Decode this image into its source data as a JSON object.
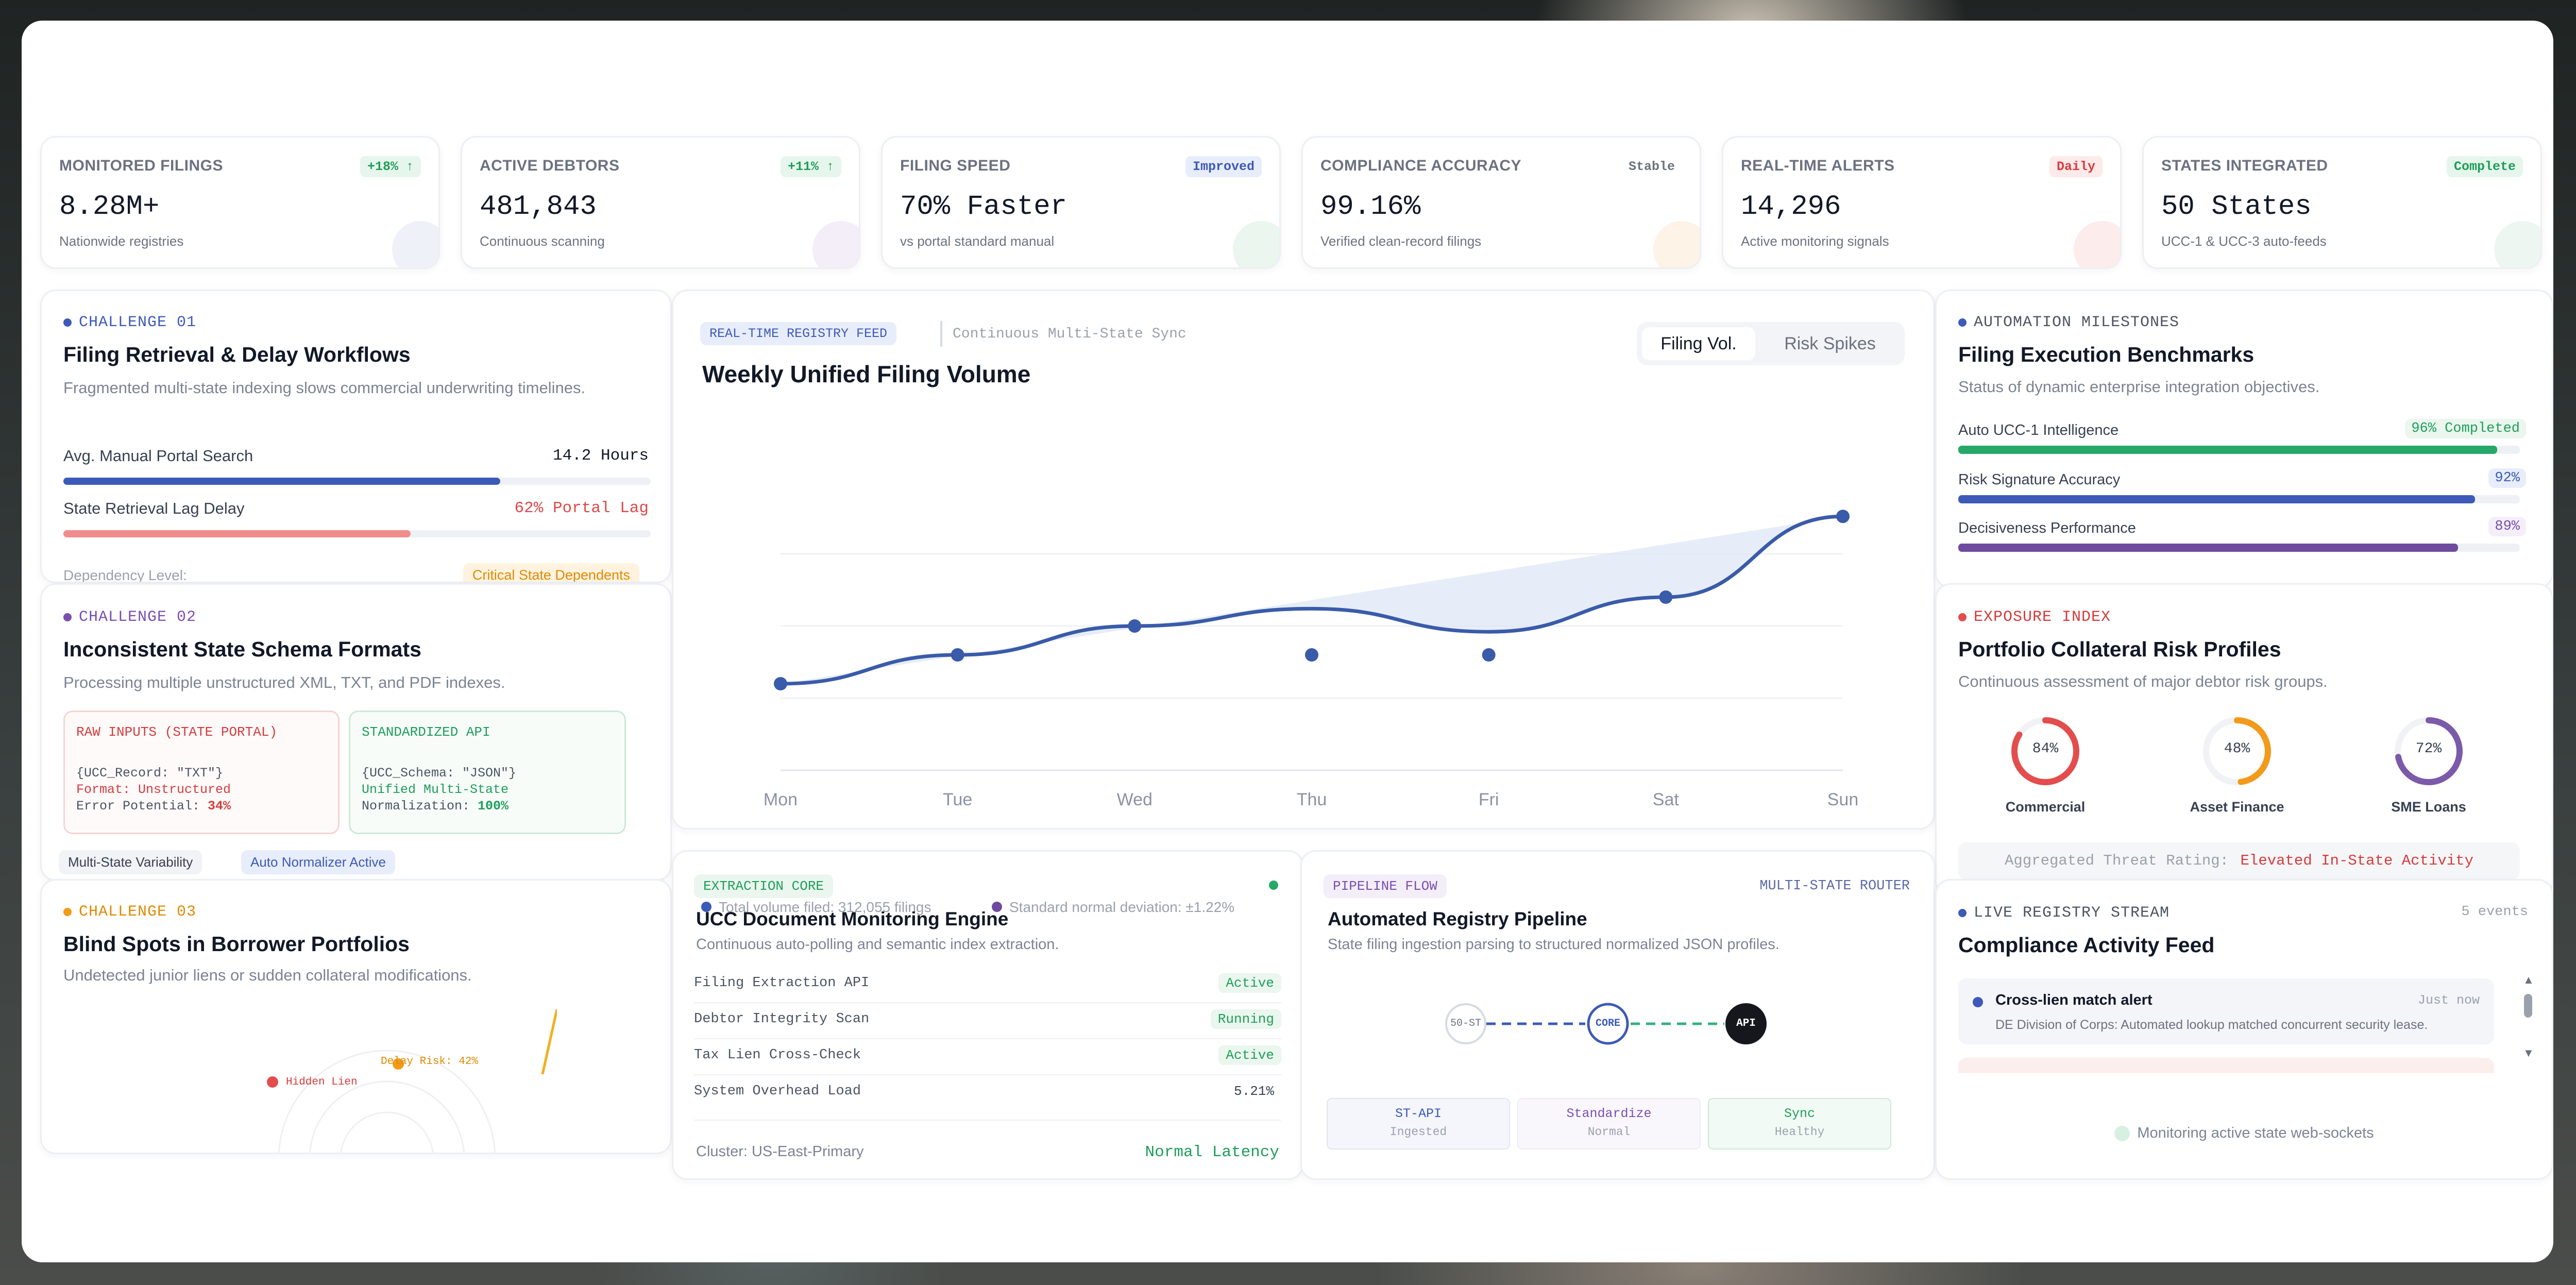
{
  "kpis": [
    {
      "label": "MONITORED FILINGS",
      "badge": "+18% ↑",
      "value": "8.28M+",
      "sub": "Nationwide registries"
    },
    {
      "label": "ACTIVE DEBTORS",
      "badge": "+11% ↑",
      "value": "481,843",
      "sub": "Continuous scanning"
    },
    {
      "label": "FILING SPEED",
      "badge": "Improved",
      "value": "70% Faster",
      "sub": "vs portal standard manual"
    },
    {
      "label": "COMPLIANCE ACCURACY",
      "badge": "Stable",
      "value": "99.16%",
      "sub": "Verified clean-record filings"
    },
    {
      "label": "REAL-TIME ALERTS",
      "badge": "Daily",
      "value": "14,296",
      "sub": "Active monitoring signals"
    },
    {
      "label": "STATES INTEGRATED",
      "badge": "Complete",
      "value": "50 States",
      "sub": "UCC-1 & UCC-3 auto-feeds"
    }
  ],
  "challenge1": {
    "tag": "CHALLENGE 01",
    "title": "Filing Retrieval & Delay Workflows",
    "desc": "Fragmented multi-state indexing slows commercial underwriting timelines.",
    "row1_label": "Avg. Manual Portal Search",
    "row1_value": "14.2 Hours",
    "row1_level": 0.7,
    "row2_label": "State Retrieval Lag Delay",
    "row2_value": "62% Portal Lag",
    "row2_level": 0.62,
    "dep_label": "Dependency Level:",
    "dep_value": "Critical State Dependents"
  },
  "challenge2": {
    "tag": "CHALLENGE 02",
    "title": "Inconsistent State Schema Formats",
    "desc": "Processing multiple unstructured XML, TXT, and PDF indexes.",
    "raw_title": "RAW INPUTS (STATE PORTAL)",
    "raw_l1": "{UCC_Record: \"TXT\"}",
    "raw_l2_k": "Format: ",
    "raw_l2_v": "Unstructured",
    "raw_l3_k": "Error Potential: ",
    "raw_l3_v": "34%",
    "api_title": "STANDARDIZED API",
    "api_l1": "{UCC_Schema: \"JSON\"}",
    "api_l2": "Unified Multi-State",
    "api_l3_k": "Normalization: ",
    "api_l3_v": "100%",
    "pill1": "Multi-State Variability",
    "pill2": "Auto Normalizer Active"
  },
  "challenge3": {
    "tag": "CHALLENGE 03",
    "title": "Blind Spots in Borrower Portfolios",
    "desc": "Undetected junior liens or sudden collateral modifications.",
    "label_delay": "Delay Risk: 42%",
    "label_hidden": "Hidden Lien"
  },
  "feed": {
    "tag": "REAL-TIME REGISTRY FEED",
    "sub": "Continuous Multi-State Sync",
    "title": "Weekly Unified Filing Volume",
    "toggle1": "Filing Vol.",
    "toggle2": "Risk Spikes"
  },
  "chart_data": {
    "type": "line",
    "categories": [
      "Mon",
      "Tue",
      "Wed",
      "Thu",
      "Fri",
      "Sat",
      "Sun"
    ],
    "series": [
      {
        "values": [
          30,
          40,
          50,
          56,
          48,
          60,
          88
        ]
      },
      {
        "values": [
          30,
          40,
          null,
          40,
          40,
          null,
          88
        ]
      }
    ],
    "ylim": [
      0,
      100
    ],
    "grid": true,
    "colors": {
      "line": "#3a5ba9",
      "area": "#dde5f5"
    }
  },
  "milestones": {
    "tag": "AUTOMATION MILESTONES",
    "title": "Filing Execution Benchmarks",
    "desc": "Status of dynamic enterprise integration objectives.",
    "items": [
      {
        "label": "Auto UCC-1 Intelligence",
        "value": "96% Completed",
        "level": 0.96
      },
      {
        "label": "Risk Signature Accuracy",
        "value": "92%",
        "level": 0.92
      },
      {
        "label": "Decisiveness Performance",
        "value": "89%",
        "level": 0.89
      }
    ]
  },
  "exposure": {
    "tag": "EXPOSURE INDEX",
    "title": "Portfolio Collateral Risk Profiles",
    "desc": "Continuous assessment of major debtor risk groups.",
    "rings": [
      {
        "pct": "84%",
        "label": "Commercial",
        "level": 0.84,
        "color": "#e44d4d"
      },
      {
        "pct": "48%",
        "label": "Asset Finance",
        "level": 0.48,
        "color": "#f29a1a"
      },
      {
        "pct": "72%",
        "label": "SME Loans",
        "level": 0.72,
        "color": "#7a5aa9"
      }
    ],
    "threat_label": "Aggregated Threat Rating:",
    "threat_value": "Elevated In-State Activity"
  },
  "extraction": {
    "tag": "EXTRACTION CORE",
    "legend1": "Total volume filed: 312,055 filings",
    "legend2": "Standard normal deviation: ±1.22%",
    "title": "UCC Document Monitoring Engine",
    "desc": "Continuous auto-polling and semantic index extraction.",
    "rows": [
      {
        "name": "Filing Extraction API",
        "status": "Active"
      },
      {
        "name": "Debtor Integrity Scan",
        "status": "Running"
      },
      {
        "name": "Tax Lien Cross-Check",
        "status": "Active"
      },
      {
        "name": "System Overhead Load",
        "status": "5.21%"
      }
    ],
    "cluster": "Cluster: US-East-Primary",
    "latency": "Normal Latency"
  },
  "pipeline": {
    "tag": "PIPELINE FLOW",
    "router": "MULTI-STATE ROUTER",
    "title": "Automated Registry Pipeline",
    "desc": "State filing ingestion parsing to structured normalized JSON profiles.",
    "node1": "50-ST",
    "node2": "CORE",
    "node3": "API",
    "stages": [
      {
        "name": "ST-API",
        "state": "Ingested"
      },
      {
        "name": "Standardize",
        "state": "Normal"
      },
      {
        "name": "Sync",
        "state": "Healthy"
      }
    ]
  },
  "stream": {
    "tag": "LIVE REGISTRY STREAM",
    "count": "5 events",
    "title": "Compliance Activity Feed",
    "item_title": "Cross-lien match alert",
    "item_time": "Just now",
    "item_desc": "DE Division of Corps: Automated lookup matched concurrent security lease.",
    "footer": "Monitoring active state web-sockets"
  }
}
